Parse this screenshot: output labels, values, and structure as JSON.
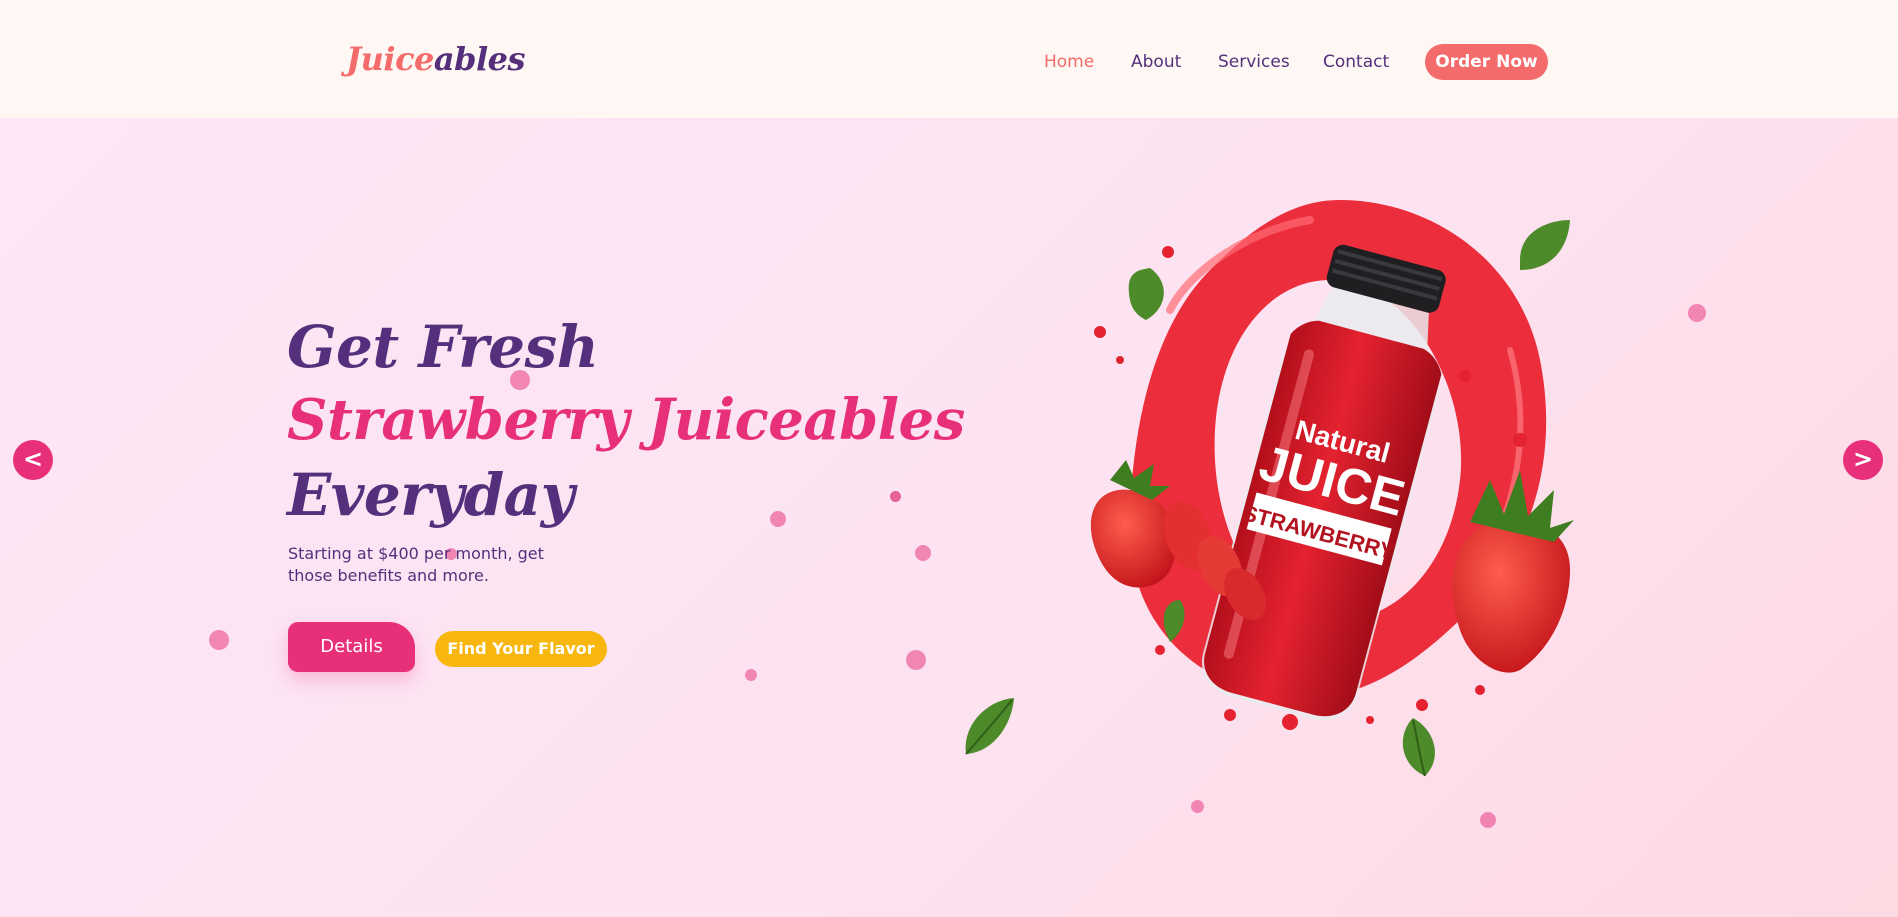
{
  "brand": {
    "part1": "Juice",
    "part2": "ables"
  },
  "nav": [
    {
      "label": "Home",
      "active": true
    },
    {
      "label": "About"
    },
    {
      "label": "Services"
    },
    {
      "label": "Contact"
    }
  ],
  "order_button": "Order Now",
  "hero": {
    "line1": "Get Fresh",
    "line2": "Strawberry Juiceables",
    "line3": "Everyday",
    "subtitle": "Starting at $400 per month, get those benefits and more.",
    "details_button": "Details",
    "flavor_button": "Find Your Flavor"
  },
  "bottle": {
    "label_top": "Natural",
    "label_main": "JUICE",
    "label_flavor": "STRAWBERRY"
  },
  "carousel": {
    "prev": "<",
    "next": ">"
  },
  "colors": {
    "accent": "#f46b6b",
    "primary": "#54307c",
    "pink": "#e8307a",
    "yellow": "#f7b70f",
    "header_bg": "#fff7f4"
  },
  "icons": {
    "prev": "chevron-left-icon",
    "next": "chevron-right-icon",
    "leaf": "leaf-icon"
  }
}
